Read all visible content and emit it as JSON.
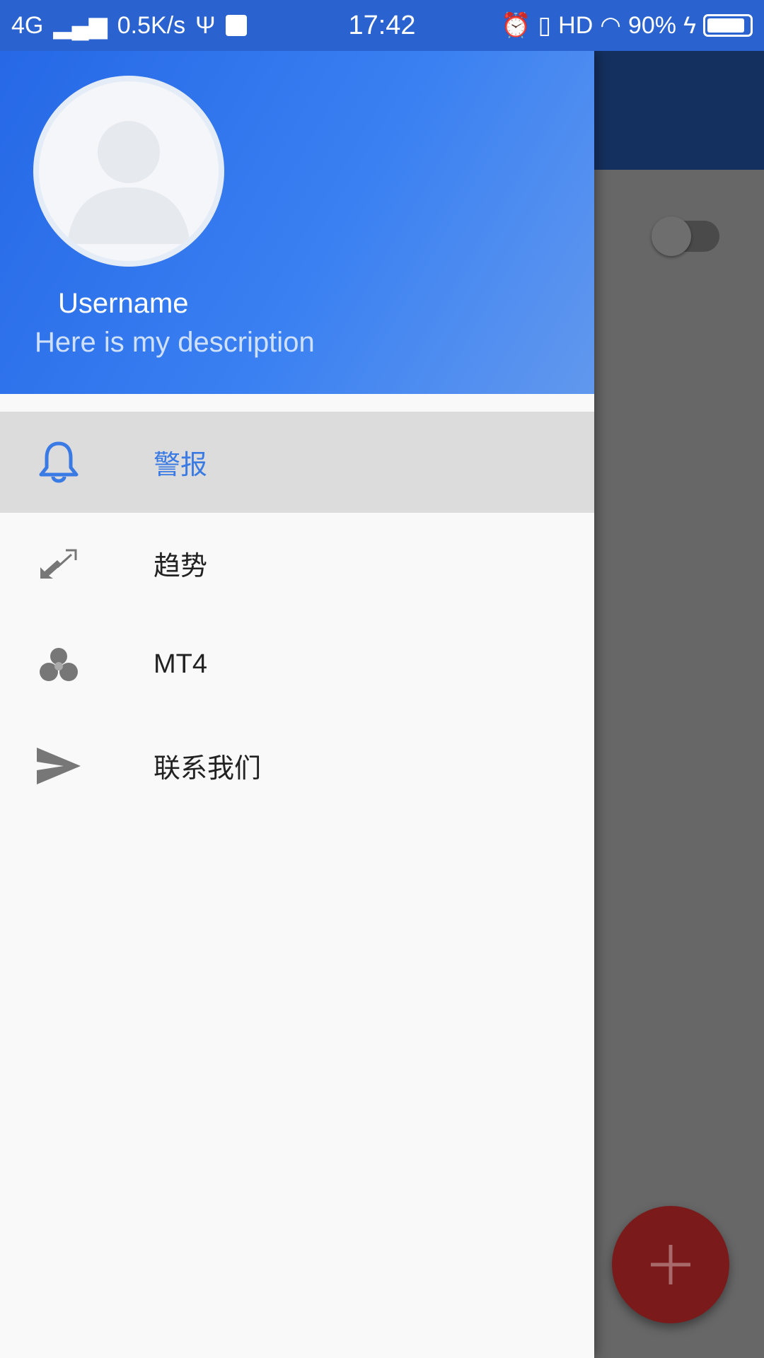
{
  "status_bar": {
    "network": "4G",
    "speed": "0.5K/s",
    "time": "17:42",
    "hd": "HD",
    "battery": "90%",
    "battery_level": 0.9
  },
  "drawer": {
    "username": "Username",
    "description": "Here is my description",
    "items": [
      {
        "label": "警报",
        "icon": "bell-icon",
        "selected": true
      },
      {
        "label": "趋势",
        "icon": "trend-arrows-icon"
      },
      {
        "label": "MT4",
        "icon": "mt4-logo-icon"
      },
      {
        "label": "联系我们",
        "icon": "send-icon"
      }
    ]
  },
  "colors": {
    "accent": "#3a7ae4",
    "header": "#2668e6",
    "fab": "#c62828"
  }
}
